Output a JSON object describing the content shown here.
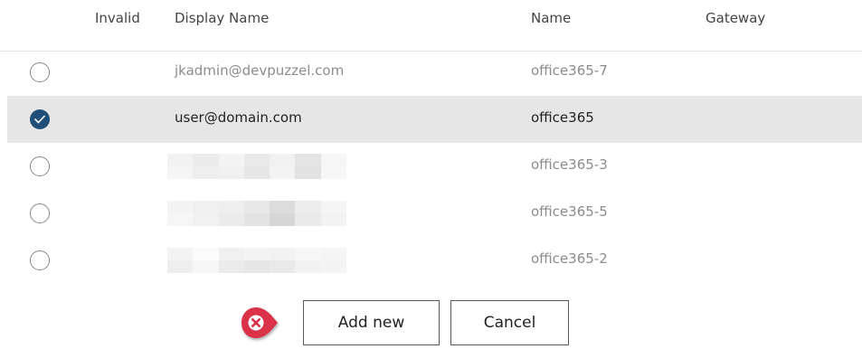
{
  "table": {
    "headers": {
      "invalid": "Invalid",
      "display_name": "Display Name",
      "name": "Name",
      "gateway": "Gateway"
    },
    "rows": [
      {
        "selected": false,
        "display_name": "jkadmin@devpuzzel.com",
        "name": "office365-7",
        "gateway": ""
      },
      {
        "selected": true,
        "display_name": "user@domain.com",
        "name": "office365",
        "gateway": ""
      },
      {
        "selected": false,
        "display_name": "",
        "name": "office365-3",
        "gateway": ""
      },
      {
        "selected": false,
        "display_name": "",
        "name": "office365-5",
        "gateway": ""
      },
      {
        "selected": false,
        "display_name": "",
        "name": "office365-2",
        "gateway": ""
      }
    ]
  },
  "actions": {
    "add_new_label": "Add new",
    "cancel_label": "Cancel"
  },
  "icons": {
    "annotation_badge": "close-badge-icon",
    "selected_check": "check-icon"
  },
  "colors": {
    "selected_row": "#e6e6e6",
    "radio_checked": "#1f4e79",
    "badge_red": "#d9324a"
  }
}
